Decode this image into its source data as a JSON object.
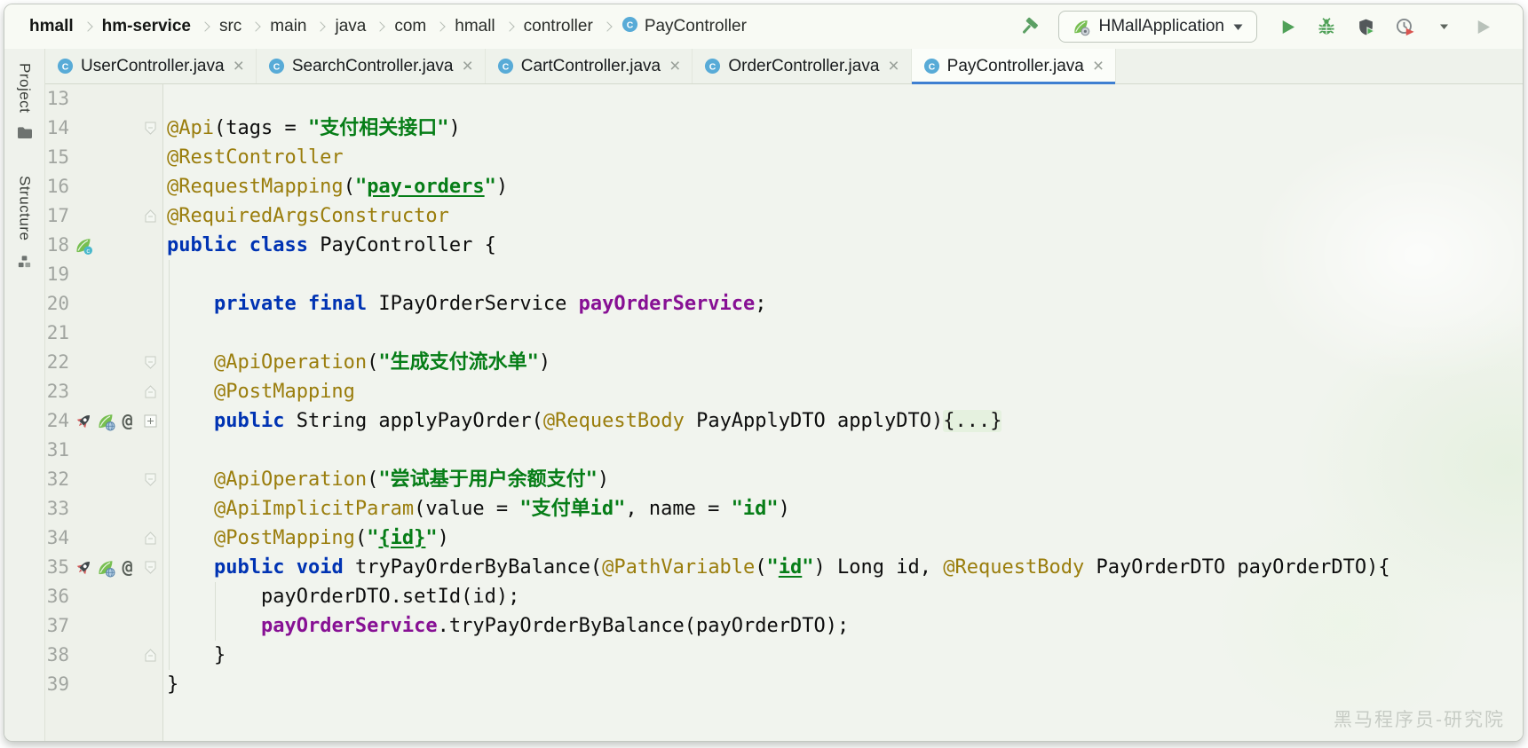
{
  "header": {
    "breadcrumb": [
      {
        "label": "hmall",
        "bold": true
      },
      {
        "label": "hm-service",
        "bold": true
      },
      {
        "label": "src"
      },
      {
        "label": "main"
      },
      {
        "label": "java"
      },
      {
        "label": "com"
      },
      {
        "label": "hmall"
      },
      {
        "label": "controller"
      },
      {
        "label": "PayController",
        "icon": "class"
      }
    ],
    "run_config": "HMallApplication",
    "actions": [
      {
        "name": "run-icon",
        "icon": "run",
        "enabled": true
      },
      {
        "name": "debug-icon",
        "icon": "debug",
        "enabled": true
      },
      {
        "name": "run-with-coverage-icon",
        "icon": "coverage",
        "enabled": true
      },
      {
        "name": "profiler-icon",
        "icon": "profiler",
        "enabled": true
      },
      {
        "name": "profiler-chevron-icon",
        "icon": "chevron-small",
        "enabled": true
      },
      {
        "name": "rerun-disabled-icon",
        "icon": "run-disabled",
        "enabled": false
      }
    ]
  },
  "tool_windows": {
    "project": "Project",
    "structure": "Structure"
  },
  "tabs": [
    {
      "label": "UserController.java"
    },
    {
      "label": "SearchController.java"
    },
    {
      "label": "CartController.java"
    },
    {
      "label": "OrderController.java"
    },
    {
      "label": "PayController.java",
      "active": true
    }
  ],
  "colors": {
    "tab_accent": "#3e7fd1",
    "string": "#067D17",
    "keyword": "#0033B3",
    "annotation": "#9a7d0c",
    "field": "#871094",
    "spring_green": "#77bf51",
    "run_green": "#4fa057"
  },
  "editor": {
    "lines": [
      {
        "num": 13,
        "segments": []
      },
      {
        "num": 14,
        "fold": "down",
        "segments": [
          {
            "t": "@Api",
            "c": "ann"
          },
          {
            "t": "(tags = ",
            "c": "pl"
          },
          {
            "t": "\"支付相关接口\"",
            "c": "str"
          },
          {
            "t": ")",
            "c": "pl"
          }
        ]
      },
      {
        "num": 15,
        "segments": [
          {
            "t": "@RestController",
            "c": "ann"
          }
        ]
      },
      {
        "num": 16,
        "segments": [
          {
            "t": "@RequestMapping",
            "c": "ann"
          },
          {
            "t": "(",
            "c": "pl"
          },
          {
            "t": "\"",
            "c": "str"
          },
          {
            "t": "pay-orders",
            "c": "stru"
          },
          {
            "t": "\"",
            "c": "str"
          },
          {
            "t": ")",
            "c": "pl"
          }
        ]
      },
      {
        "num": 17,
        "fold": "up",
        "segments": [
          {
            "t": "@RequiredArgsConstructor",
            "c": "ann"
          }
        ]
      },
      {
        "num": 18,
        "icons": [
          "spring-bean"
        ],
        "segments": [
          {
            "t": "public",
            "c": "kw"
          },
          {
            "t": " ",
            "c": "pl"
          },
          {
            "t": "class",
            "c": "kw"
          },
          {
            "t": " PayController {",
            "c": "pl"
          }
        ]
      },
      {
        "num": 19,
        "segments": []
      },
      {
        "num": 20,
        "segments": [
          {
            "t": "    ",
            "c": "pl"
          },
          {
            "t": "private",
            "c": "kw"
          },
          {
            "t": " ",
            "c": "pl"
          },
          {
            "t": "final",
            "c": "kw"
          },
          {
            "t": " IPayOrderService ",
            "c": "pl"
          },
          {
            "t": "payOrderService",
            "c": "fld"
          },
          {
            "t": ";",
            "c": "pl"
          }
        ]
      },
      {
        "num": 21,
        "segments": []
      },
      {
        "num": 22,
        "fold": "down",
        "segments": [
          {
            "t": "    ",
            "c": "pl"
          },
          {
            "t": "@ApiOperation",
            "c": "ann"
          },
          {
            "t": "(",
            "c": "pl"
          },
          {
            "t": "\"生成支付流水单\"",
            "c": "str"
          },
          {
            "t": ")",
            "c": "pl"
          }
        ]
      },
      {
        "num": 23,
        "fold": "up",
        "segments": [
          {
            "t": "    ",
            "c": "pl"
          },
          {
            "t": "@PostMapping",
            "c": "ann"
          }
        ]
      },
      {
        "num": 24,
        "icons": [
          "rocket",
          "spring-mapping",
          "at"
        ],
        "fold": "plus",
        "segments": [
          {
            "t": "    ",
            "c": "pl"
          },
          {
            "t": "public",
            "c": "kw"
          },
          {
            "t": " String applyPayOrder(",
            "c": "pl"
          },
          {
            "t": "@RequestBody",
            "c": "ann"
          },
          {
            "t": " PayApplyDTO applyDTO)",
            "c": "pl"
          },
          {
            "t": "{...}",
            "c": "fold"
          }
        ]
      },
      {
        "num": 31,
        "segments": []
      },
      {
        "num": 32,
        "fold": "down",
        "segments": [
          {
            "t": "    ",
            "c": "pl"
          },
          {
            "t": "@ApiOperation",
            "c": "ann"
          },
          {
            "t": "(",
            "c": "pl"
          },
          {
            "t": "\"尝试基于用户余额支付\"",
            "c": "str"
          },
          {
            "t": ")",
            "c": "pl"
          }
        ]
      },
      {
        "num": 33,
        "segments": [
          {
            "t": "    ",
            "c": "pl"
          },
          {
            "t": "@ApiImplicitParam",
            "c": "ann"
          },
          {
            "t": "(value = ",
            "c": "pl"
          },
          {
            "t": "\"支付单id\"",
            "c": "str"
          },
          {
            "t": ", name = ",
            "c": "pl"
          },
          {
            "t": "\"id\"",
            "c": "str"
          },
          {
            "t": ")",
            "c": "pl"
          }
        ]
      },
      {
        "num": 34,
        "fold": "up",
        "segments": [
          {
            "t": "    ",
            "c": "pl"
          },
          {
            "t": "@PostMapping",
            "c": "ann"
          },
          {
            "t": "(",
            "c": "pl"
          },
          {
            "t": "\"",
            "c": "str"
          },
          {
            "t": "{id}",
            "c": "stru"
          },
          {
            "t": "\"",
            "c": "str"
          },
          {
            "t": ")",
            "c": "pl"
          }
        ]
      },
      {
        "num": 35,
        "icons": [
          "rocket",
          "spring-mapping",
          "at"
        ],
        "fold": "down",
        "segments": [
          {
            "t": "    ",
            "c": "pl"
          },
          {
            "t": "public",
            "c": "kw"
          },
          {
            "t": " ",
            "c": "pl"
          },
          {
            "t": "void",
            "c": "kw"
          },
          {
            "t": " tryPayOrderByBalance(",
            "c": "pl"
          },
          {
            "t": "@PathVariable",
            "c": "ann"
          },
          {
            "t": "(",
            "c": "pl"
          },
          {
            "t": "\"",
            "c": "str"
          },
          {
            "t": "id",
            "c": "stru"
          },
          {
            "t": "\"",
            "c": "str"
          },
          {
            "t": ") Long id, ",
            "c": "pl"
          },
          {
            "t": "@RequestBody",
            "c": "ann"
          },
          {
            "t": " PayOrderDTO payOrderDTO){",
            "c": "pl"
          }
        ]
      },
      {
        "num": 36,
        "segments": [
          {
            "t": "        payOrderDTO.setId(id);",
            "c": "pl"
          }
        ]
      },
      {
        "num": 37,
        "segments": [
          {
            "t": "        ",
            "c": "pl"
          },
          {
            "t": "payOrderService",
            "c": "fld"
          },
          {
            "t": ".tryPayOrderByBalance(payOrderDTO);",
            "c": "pl"
          }
        ]
      },
      {
        "num": 38,
        "fold": "up",
        "segments": [
          {
            "t": "    }",
            "c": "pl"
          }
        ]
      },
      {
        "num": 39,
        "segments": [
          {
            "t": "}",
            "c": "pl"
          }
        ]
      }
    ]
  },
  "watermark": "黑马程序员-研究院"
}
